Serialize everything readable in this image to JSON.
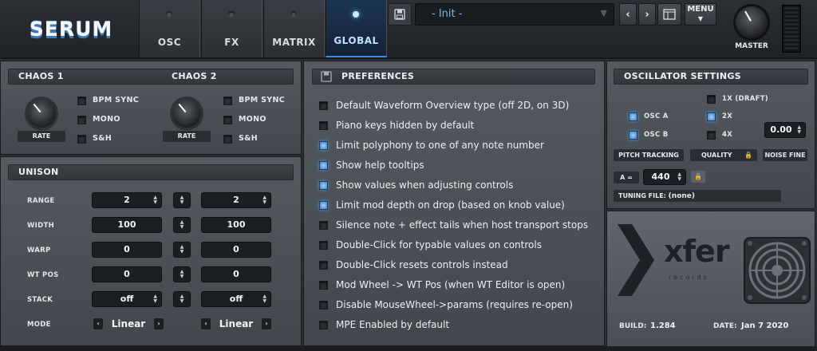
{
  "header": {
    "logo": "SERUM",
    "tabs": [
      {
        "label": "OSC",
        "active": false
      },
      {
        "label": "FX",
        "active": false
      },
      {
        "label": "MATRIX",
        "active": false
      },
      {
        "label": "GLOBAL",
        "active": true
      }
    ],
    "preset_name": "- Init -",
    "menu_label": "MENU",
    "master_label": "MASTER"
  },
  "chaos": {
    "chaos1_title": "CHAOS 1",
    "chaos2_title": "CHAOS 2",
    "rate_label": "RATE",
    "options": [
      "BPM SYNC",
      "MONO",
      "S&H"
    ]
  },
  "unison": {
    "title": "UNISON",
    "rows": [
      {
        "label": "RANGE",
        "a": "2",
        "b": "2"
      },
      {
        "label": "WIDTH",
        "a": "100",
        "b": "100"
      },
      {
        "label": "WARP",
        "a": "0",
        "b": "0"
      },
      {
        "label": "WT POS",
        "a": "0",
        "b": "0"
      },
      {
        "label": "STACK",
        "a": "off",
        "b": "off"
      }
    ],
    "mode_label": "MODE",
    "mode_a": "Linear",
    "mode_b": "Linear"
  },
  "preferences": {
    "title": "PREFERENCES",
    "items": [
      {
        "label": "Default Waveform Overview type (off 2D, on 3D)",
        "checked": false
      },
      {
        "label": "Piano keys hidden by default",
        "checked": false
      },
      {
        "label": "Limit polyphony to one of any note number",
        "checked": true
      },
      {
        "label": "Show help tooltips",
        "checked": true
      },
      {
        "label": "Show values when adjusting controls",
        "checked": true
      },
      {
        "label": "Limit mod depth on drop (based on knob value)",
        "checked": true
      },
      {
        "label": "Silence note + effect tails when host transport stops",
        "checked": false
      },
      {
        "label": "Double-Click for typable values on controls",
        "checked": false
      },
      {
        "label": "Double-Click resets controls instead",
        "checked": false
      },
      {
        "label": "Mod Wheel -> WT Pos (when WT Editor is open)",
        "checked": false
      },
      {
        "label": "Disable MouseWheel->params (requires re-open)",
        "checked": false
      },
      {
        "label": "MPE Enabled by default",
        "checked": false
      }
    ]
  },
  "osc_settings": {
    "title": "OSCILLATOR SETTINGS",
    "osc_a": "OSC A",
    "osc_b": "OSC B",
    "q1x": "1X (DRAFT)",
    "q2x": "2X",
    "q4x": "4X",
    "noise_value": "0.00",
    "pitch_tracking": "PITCH TRACKING",
    "quality": "QUALITY",
    "noise_fine": "NOISE FINE",
    "a_eq": "A =",
    "a_value": "440",
    "tuning_label": "TUNING FILE:",
    "tuning_value": "(none)"
  },
  "about": {
    "brand": "xfer",
    "brand_sub": "records",
    "build_label": "BUILD:",
    "build_value": "1.284",
    "date_label": "DATE:",
    "date_value": "Jan 7 2020"
  },
  "colors": {
    "accent": "#3e8ee0",
    "panel": "#4d5158"
  }
}
